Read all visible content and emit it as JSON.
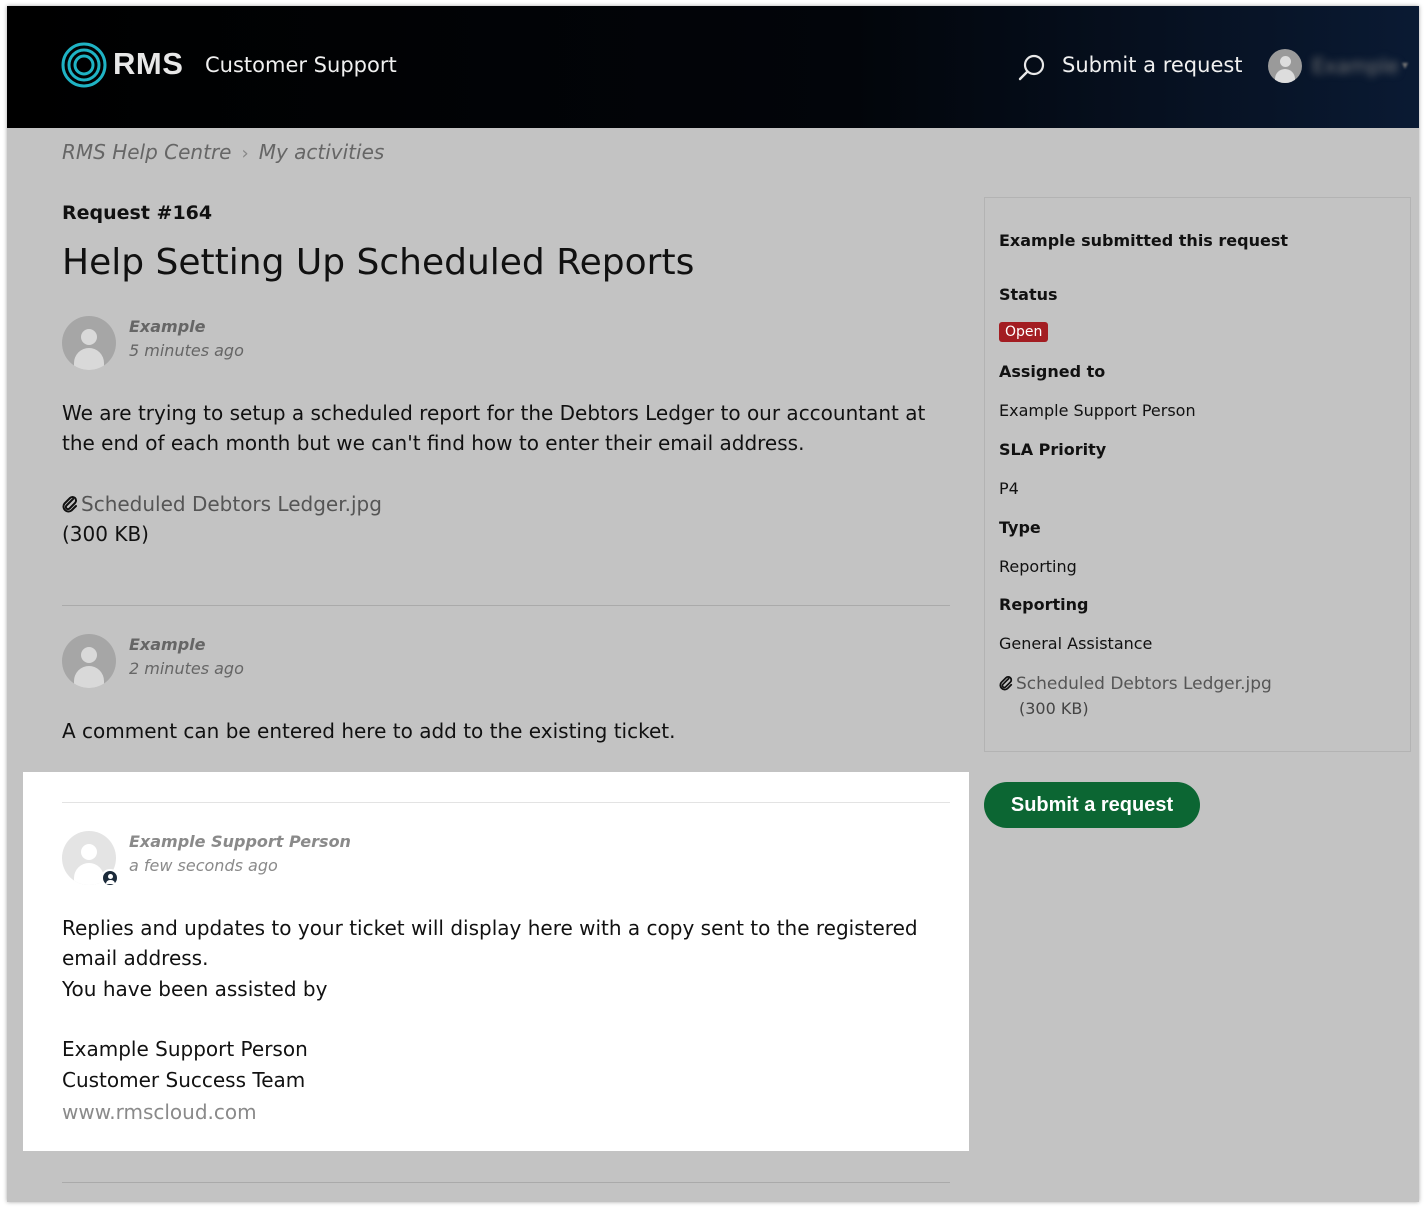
{
  "header": {
    "logo_text": "RMS",
    "title": "Customer Support",
    "submit_label": "Submit a request",
    "user_name": "Example",
    "caret": "▾",
    "icons": {
      "logo": "rms-logo-icon",
      "search": "search-icon",
      "avatar": "user-avatar-icon",
      "caret": "chevron-down-icon"
    }
  },
  "breadcrumb": {
    "home": "RMS Help Centre",
    "separator": "›",
    "current": "My activities"
  },
  "request": {
    "number": "Request #164",
    "title": "Help Setting Up Scheduled Reports"
  },
  "comments": [
    {
      "author": "Example",
      "time": "5 minutes ago",
      "text": "We are trying to setup a scheduled report for the Debtors Ledger to our accountant at the end of each month but we can't find how to enter their email address.",
      "attachment_name": "Scheduled Debtors Ledger.jpg",
      "attachment_size": "(300 KB)"
    },
    {
      "author": "Example",
      "time": "2 minutes ago",
      "text": "A comment can be entered here to add to the existing ticket."
    },
    {
      "author": "Example Support Person",
      "time": "a few seconds ago",
      "line1": "Replies and updates to your ticket will display here with a copy sent to the registered email address.",
      "line2": "You have been assisted by",
      "sig_name": "Example Support Person",
      "sig_team": "Customer Success Team",
      "sig_link": "www.rmscloud.com"
    }
  ],
  "sidebar": {
    "submitted_by": "Example submitted this request",
    "status_label": "Status",
    "status_value": "Open",
    "assigned_label": "Assigned to",
    "assigned_value": "Example Support Person",
    "sla_label": "SLA Priority",
    "sla_value": "P4",
    "type_label": "Type",
    "type_value": "Reporting",
    "reporting_label": "Reporting",
    "reporting_value": "General Assistance",
    "attachment_name": "Scheduled Debtors Ledger.jpg",
    "attachment_size": "(300 KB)"
  },
  "submit_button": "Submit a request",
  "colors": {
    "header_bg": "#000000",
    "page_bg": "#c3c3c3",
    "status_open": "#a31d22",
    "submit_button": "#0c6633",
    "logo_accent": "#1fb3c4"
  }
}
